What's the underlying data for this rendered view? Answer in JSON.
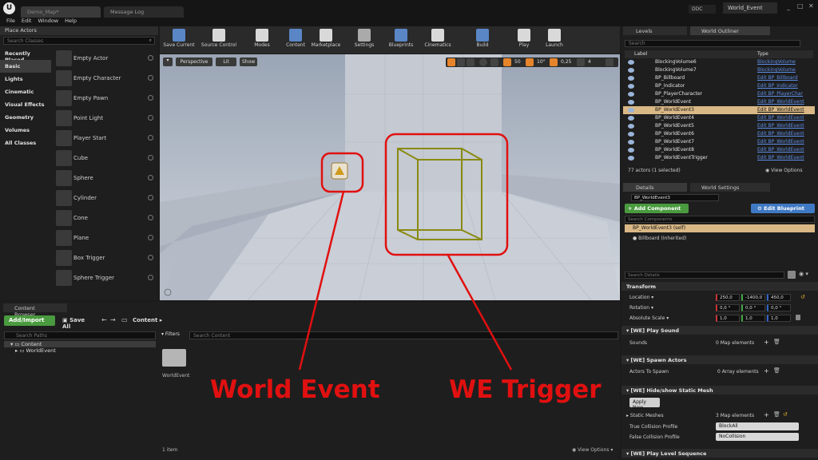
{
  "titlebar": {
    "tabs": [
      "Demo_Map*",
      "Message Log"
    ],
    "ddc": "DDC",
    "project": "World_Event"
  },
  "menu": [
    "File",
    "Edit",
    "Window",
    "Help"
  ],
  "place_actors": {
    "title": "Place Actors",
    "search_placeholder": "Search Classes",
    "categories": [
      "Recently Placed",
      "Basic",
      "Lights",
      "Cinematic",
      "Visual Effects",
      "Geometry",
      "Volumes",
      "All Classes"
    ],
    "selected_category": "Basic",
    "actors": [
      "Empty Actor",
      "Empty Character",
      "Empty Pawn",
      "Point Light",
      "Player Start",
      "Cube",
      "Sphere",
      "Cylinder",
      "Cone",
      "Plane",
      "Box Trigger",
      "Sphere Trigger"
    ]
  },
  "toolbar": {
    "buttons": [
      "Save Current",
      "Source Control",
      "Modes",
      "Content",
      "Marketplace",
      "Settings",
      "Blueprints",
      "Cinematics",
      "Build",
      "Play",
      "Launch"
    ]
  },
  "viewport": {
    "perspective": "Perspective",
    "lit": "Lit",
    "show": "Show",
    "grid_snap": "50",
    "rot_snap": "10°",
    "scale_snap": "0,25",
    "cam_speed": "4"
  },
  "annotations": {
    "world_event": "World Event",
    "we_trigger": "WE Trigger",
    "color": "#e11010"
  },
  "content_browser": {
    "title": "Content Browser",
    "add_import": "Add/Import",
    "save_all": "Save All",
    "path": "Content",
    "search_paths": "Search Paths",
    "filters": "Filters",
    "search_content": "Search Content",
    "tree": [
      "Content",
      "WorldEvent"
    ],
    "folder_name": "WorldEvent",
    "item_count": "1 item",
    "view_options": "View Options"
  },
  "levels_tab": "Levels",
  "outliner": {
    "title": "World Outliner",
    "search": "Search",
    "col_label": "Label",
    "col_type": "Type",
    "rows": [
      {
        "label": "BlockingVolume6",
        "type": "BlockingVolume"
      },
      {
        "label": "BlockingVolume7",
        "type": "BlockingVolume"
      },
      {
        "label": "BP_Billboard",
        "type": "Edit BP_Billboard"
      },
      {
        "label": "BP_Indicator",
        "type": "Edit BP_Indicator"
      },
      {
        "label": "BP_PlayerCharacter",
        "type": "Edit BP_PlayerChar"
      },
      {
        "label": "BP_WorldEvent",
        "type": "Edit BP_WorldEvent"
      },
      {
        "label": "BP_WorldEvent3",
        "type": "Edit BP_WorldEvent"
      },
      {
        "label": "BP_WorldEvent4",
        "type": "Edit BP_WorldEvent"
      },
      {
        "label": "BP_WorldEvent5",
        "type": "Edit BP_WorldEvent"
      },
      {
        "label": "BP_WorldEvent6",
        "type": "Edit BP_WorldEvent"
      },
      {
        "label": "BP_WorldEvent7",
        "type": "Edit BP_WorldEvent"
      },
      {
        "label": "BP_WorldEvent8",
        "type": "Edit BP_WorldEvent"
      },
      {
        "label": "BP_WorldEventTrigger",
        "type": "Edit BP_WorldEvent"
      }
    ],
    "selected_index": 6,
    "footer": "77 actors (1 selected)",
    "view_options": "View Options"
  },
  "details": {
    "tab": "Details",
    "tab2": "World Settings",
    "name": "BP_WorldEvent3",
    "add_component": "+ Add Component",
    "edit_blueprint": "Edit Blueprint",
    "search_components": "Search Components",
    "self_row": "BP_WorldEvent3 (self)",
    "billboard_row": "Billboard (Inherited)",
    "search_details": "Search Details",
    "transform": {
      "title": "Transform",
      "location_label": "Location",
      "rotation_label": "Rotation",
      "scale_label": "Absolute Scale",
      "location": [
        "250,0",
        "-1400,0",
        "450,0"
      ],
      "rotation": [
        "0,0 °",
        "0,0 °",
        "0,0 °"
      ],
      "scale": [
        "1,0",
        "1,0",
        "1,0"
      ]
    },
    "play_sound": {
      "title": "[WE] Play Sound",
      "label": "Sounds",
      "value": "0 Map elements"
    },
    "spawn_actors": {
      "title": "[WE] Spawn Actors",
      "label": "Actors To Spawn",
      "value": "0 Array elements"
    },
    "hide_show": {
      "title": "[WE] Hide/show Static Mesh",
      "apply": "Apply Now",
      "static_meshes": "Static Meshes",
      "static_value": "3 Map elements",
      "true_profile_label": "True Collision Profile",
      "true_profile": "BlockAll",
      "false_profile_label": "False Collision Profile",
      "false_profile": "NoCollision"
    },
    "level_sequence": {
      "title": "[WE] Play Level Sequence"
    }
  }
}
